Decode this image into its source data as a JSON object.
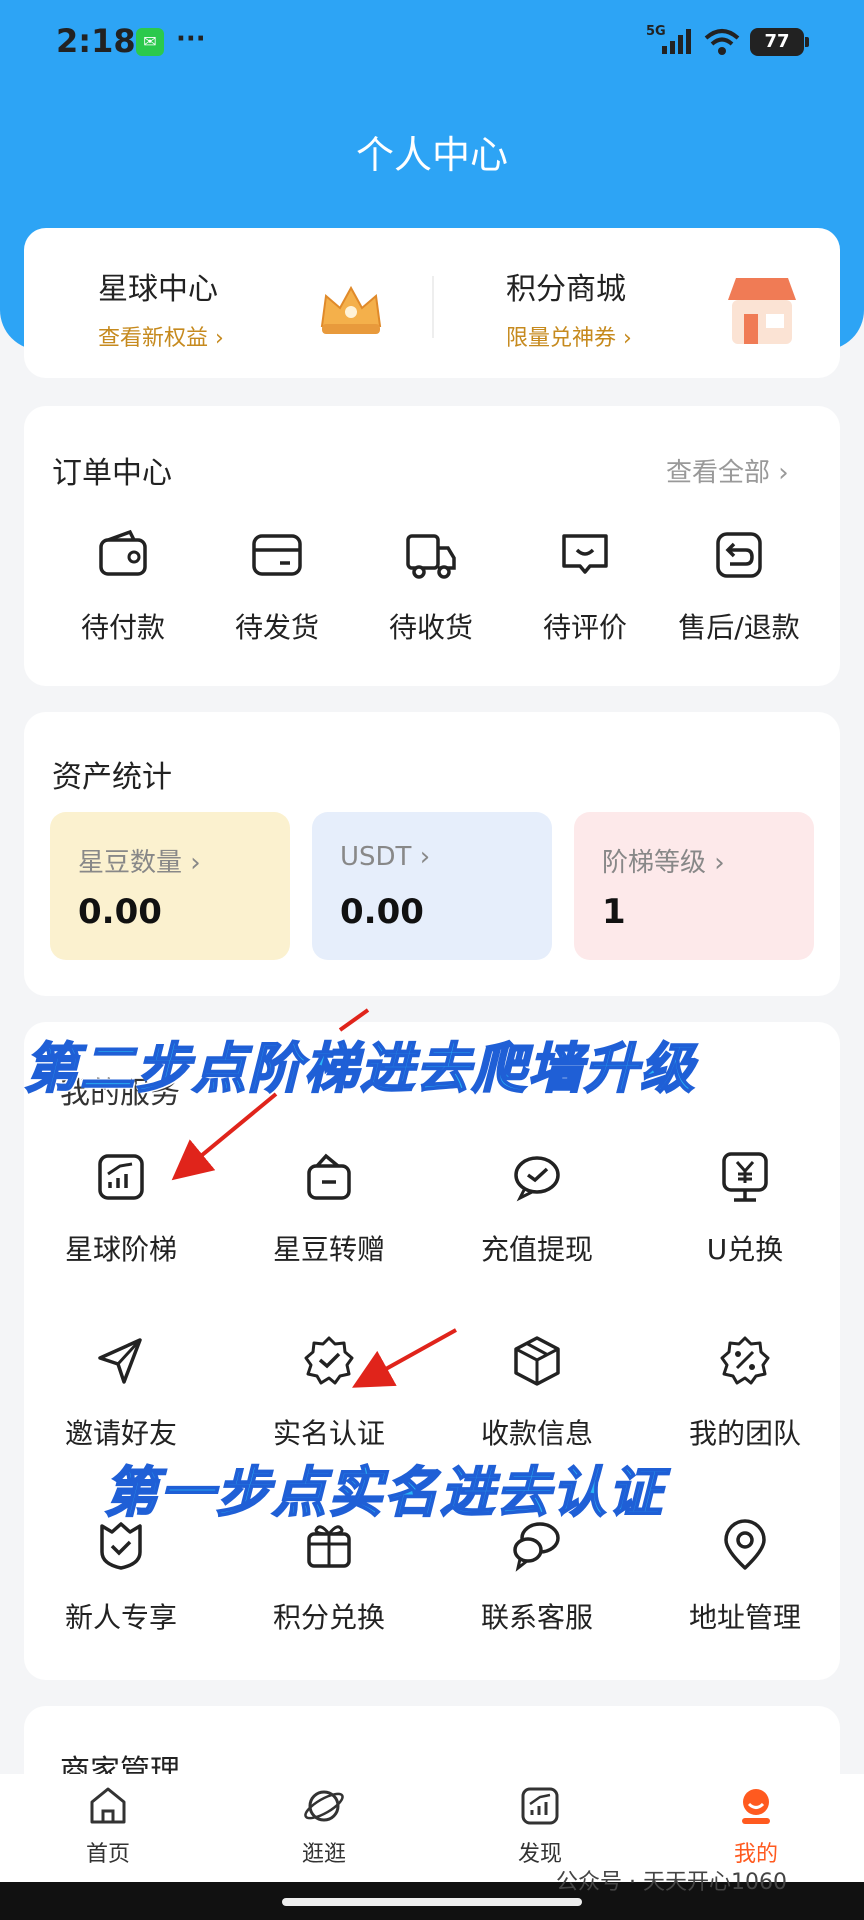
{
  "status": {
    "time": "2:18",
    "network": "5G",
    "battery": "77",
    "more": "···"
  },
  "header": {
    "title": "个人中心"
  },
  "promo": [
    {
      "title": "星球中心",
      "sub": "查看新权益 ›"
    },
    {
      "title": "积分商城",
      "sub": "限量兑神券 ›"
    }
  ],
  "orders": {
    "title": "订单中心",
    "view_all": "查看全部 ›",
    "items": [
      {
        "label": "待付款",
        "icon": "wallet-icon"
      },
      {
        "label": "待发货",
        "icon": "card-icon"
      },
      {
        "label": "待收货",
        "icon": "truck-icon"
      },
      {
        "label": "待评价",
        "icon": "comment-icon"
      },
      {
        "label": "售后/退款",
        "icon": "return-icon"
      }
    ]
  },
  "assets": {
    "title": "资产统计",
    "items": [
      {
        "label": "星豆数量 ›",
        "value": "0.00",
        "color": "#fbf1cf"
      },
      {
        "label": "USDT ›",
        "value": "0.00",
        "color": "#e6eefb"
      },
      {
        "label": "阶梯等级 ›",
        "value": "1",
        "color": "#fde9ea"
      }
    ]
  },
  "services": {
    "title": "我的服务",
    "items": [
      {
        "label": "星球阶梯",
        "icon": "chart-icon"
      },
      {
        "label": "星豆转赠",
        "icon": "gift-bag-icon"
      },
      {
        "label": "充值提现",
        "icon": "check-bubble-icon"
      },
      {
        "label": "U兑换",
        "icon": "yen-screen-icon"
      },
      {
        "label": "邀请好友",
        "icon": "send-icon"
      },
      {
        "label": "实名认证",
        "icon": "verified-badge-icon"
      },
      {
        "label": "收款信息",
        "icon": "box-icon"
      },
      {
        "label": "我的团队",
        "icon": "percent-badge-icon"
      },
      {
        "label": "新人专享",
        "icon": "shield-check-icon"
      },
      {
        "label": "积分兑换",
        "icon": "gift-icon"
      },
      {
        "label": "联系客服",
        "icon": "chat-icon"
      },
      {
        "label": "地址管理",
        "icon": "location-icon"
      }
    ]
  },
  "merchant": {
    "title": "商家管理"
  },
  "annotations": {
    "step2": "第二步点阶梯进去爬墙升级",
    "step1": "第一步点实名进去认证"
  },
  "tabs": [
    {
      "label": "首页",
      "icon": "home-icon",
      "color": "#333333"
    },
    {
      "label": "逛逛",
      "icon": "planet-icon",
      "color": "#333333"
    },
    {
      "label": "发现",
      "icon": "chart-box-icon",
      "color": "#333333"
    },
    {
      "label": "我的",
      "icon": "profile-icon",
      "color": "#ff5a1f"
    }
  ],
  "watermark": "公众号 · 天天开心1060",
  "colors": {
    "header": "#2da4f5",
    "accent": "#ff5a1f",
    "gold": "#c68a1e",
    "arrow": "#e0241b"
  }
}
